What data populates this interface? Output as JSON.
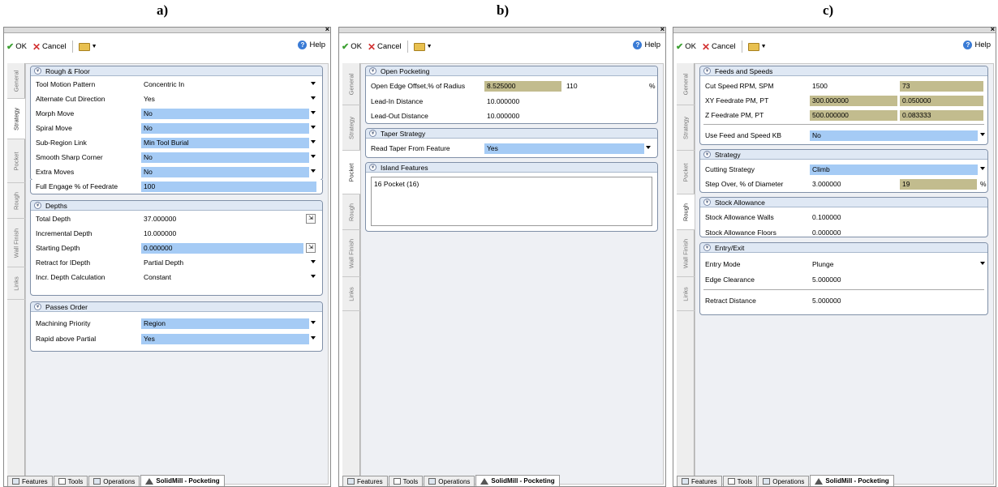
{
  "panels": [
    {
      "label": "a)",
      "toolbar": {
        "ok": "OK",
        "cancel": "Cancel",
        "help": "Help"
      },
      "tabs": [
        "General",
        "Strategy",
        "Pocket",
        "Rough",
        "Wall Finish",
        "Links"
      ],
      "sections": [
        {
          "title": "Rough & Floor",
          "rows": [
            {
              "label": "Tool Motion Pattern",
              "value": "Concentric In"
            },
            {
              "label": "Alternate Cut Direction",
              "value": "Yes"
            },
            {
              "label": "Morph Move",
              "value": "No"
            },
            {
              "label": "Spiral Move",
              "value": "No"
            },
            {
              "label": "Sub-Region Link",
              "value": "Min Tool Burial"
            },
            {
              "label": "Smooth Sharp Corner",
              "value": "No"
            },
            {
              "label": "Extra Moves",
              "value": "No"
            },
            {
              "label": "Full Engage % of Feedrate",
              "value": "100"
            }
          ]
        },
        {
          "title": "Depths",
          "rows": [
            {
              "label": "Total Depth",
              "value": "37.000000"
            },
            {
              "label": "Incremental Depth",
              "value": "10.000000"
            },
            {
              "label": "Starting Depth",
              "value": "0.000000"
            },
            {
              "label": "Retract for IDepth",
              "value": "Partial Depth"
            },
            {
              "label": "Incr. Depth Calculation",
              "value": "Constant"
            }
          ]
        },
        {
          "title": "Passes Order",
          "rows": [
            {
              "label": "Machining Priority",
              "value": "Region"
            },
            {
              "label": "Rapid above Partial",
              "value": "Yes"
            }
          ]
        }
      ],
      "bottom_tabs": [
        "Features",
        "Tools",
        "Operations",
        "SolidMill - Pocketing"
      ]
    },
    {
      "label": "b)",
      "toolbar": {
        "ok": "OK",
        "cancel": "Cancel",
        "help": "Help"
      },
      "tabs": [
        "General",
        "Strategy",
        "Pocket",
        "Rough",
        "Wall Finish",
        "Links"
      ],
      "sections": [
        {
          "title": "Open Pocketing",
          "rows": [
            {
              "label": "Open Edge Offset,% of Radius",
              "value": "8.525000",
              "value2": "110",
              "unit": "%"
            },
            {
              "label": "Lead-In Distance",
              "value": "10.000000"
            },
            {
              "label": "Lead-Out Distance",
              "value": "10.000000"
            }
          ]
        },
        {
          "title": "Taper Strategy",
          "rows": [
            {
              "label": "Read Taper From Feature",
              "value": "Yes"
            }
          ]
        },
        {
          "title": "Island Features",
          "items": [
            "16 Pocket (16)"
          ]
        }
      ],
      "bottom_tabs": [
        "Features",
        "Tools",
        "Operations",
        "SolidMill - Pocketing"
      ]
    },
    {
      "label": "c)",
      "toolbar": {
        "ok": "OK",
        "cancel": "Cancel",
        "help": "Help"
      },
      "tabs": [
        "General",
        "Strategy",
        "Pocket",
        "Rough",
        "Wall Finish",
        "Links"
      ],
      "sections": [
        {
          "title": "Feeds and Speeds",
          "rows": [
            {
              "label": "Cut Speed RPM, SPM",
              "value": "1500",
              "value2": "73"
            },
            {
              "label": "XY Feedrate PM, PT",
              "value": "300.000000",
              "value2": "0.050000"
            },
            {
              "label": "Z Feedrate PM, PT",
              "value": "500.000000",
              "value2": "0.083333"
            },
            {
              "label": "Use Feed and Speed KB",
              "value": "No"
            }
          ]
        },
        {
          "title": "Strategy",
          "rows": [
            {
              "label": "Cutting Strategy",
              "value": "Climb"
            },
            {
              "label": "Step Over, % of Diameter",
              "value": "3.000000",
              "value2": "19",
              "unit": "%"
            }
          ]
        },
        {
          "title": "Stock Allowance",
          "rows": [
            {
              "label": "Stock Allowance Walls",
              "value": "0.100000"
            },
            {
              "label": "Stock Allowance Floors",
              "value": "0.000000"
            }
          ]
        },
        {
          "title": "Entry/Exit",
          "rows": [
            {
              "label": "Entry Mode",
              "value": "Plunge"
            },
            {
              "label": "Edge Clearance",
              "value": "5.000000"
            },
            {
              "label": "Retract Distance",
              "value": "5.000000"
            }
          ]
        }
      ],
      "bottom_tabs": [
        "Features",
        "Tools",
        "Operations",
        "SolidMill - Pocketing"
      ]
    }
  ]
}
